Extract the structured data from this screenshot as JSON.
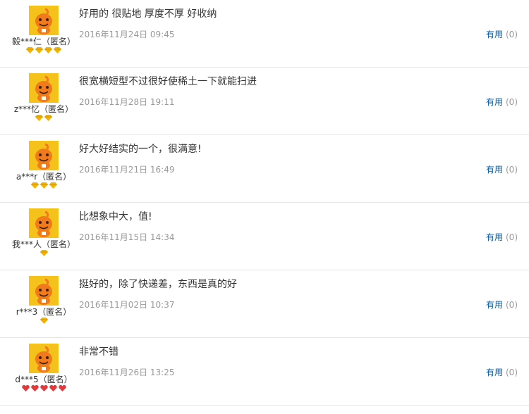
{
  "useful_label": "有用",
  "reviews": [
    {
      "username": "毅***仁（匿名）",
      "content": "好用的 很贴地 厚度不厚 好收纳",
      "time": "2016年11月24日 09:45",
      "useful_count": "(0)",
      "level_icon": "gold-diamond",
      "level_count": 4
    },
    {
      "username": "z***忆（匿名）",
      "content": "很宽横短型不过很好使稀土一下就能扫进",
      "time": "2016年11月28日 19:11",
      "useful_count": "(0)",
      "level_icon": "gold-diamond",
      "level_count": 2
    },
    {
      "username": "a***r（匿名）",
      "content": "好大好结实的一个，很满意!",
      "time": "2016年11月21日 16:49",
      "useful_count": "(0)",
      "level_icon": "gold-diamond",
      "level_count": 3
    },
    {
      "username": "我***人（匿名）",
      "content": "比想象中大，值!",
      "time": "2016年11月15日 14:34",
      "useful_count": "(0)",
      "level_icon": "gold-diamond",
      "level_count": 1
    },
    {
      "username": "r***3（匿名）",
      "content": "挺好的，除了快递差，东西是真的好",
      "time": "2016年11月02日 10:37",
      "useful_count": "(0)",
      "level_icon": "gold-diamond",
      "level_count": 1
    },
    {
      "username": "d***5（匿名）",
      "content": "非常不错",
      "time": "2016年11月26日 13:25",
      "useful_count": "(0)",
      "level_icon": "red-heart",
      "level_count": 5
    }
  ],
  "colors": {
    "avatar_bg": "#f5c21b",
    "mascot": "#f07a1c",
    "gold_diamond": "#f3b400",
    "red_heart": "#e4393c",
    "useful_link": "#005ea7",
    "meta_text": "#999999",
    "divider": "#e6e6e6"
  }
}
